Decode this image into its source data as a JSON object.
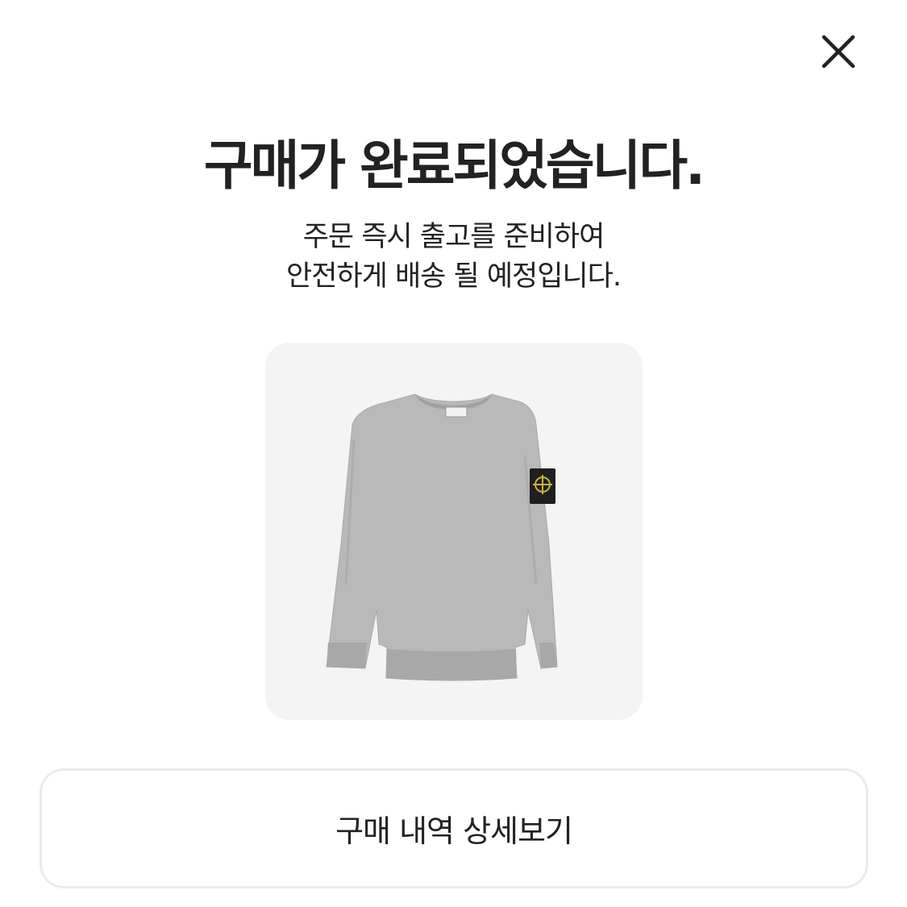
{
  "header": {
    "close_icon": "close-icon"
  },
  "main": {
    "title": "구매가 완료되었습니다.",
    "subtitle_line1": "주문 즉시 출고를 준비하여",
    "subtitle_line2": "안전하게 배송 될 예정입니다."
  },
  "product": {
    "image": "gray crewneck sweatshirt with black badge on left sleeve",
    "badge_icon": "compass-badge-icon"
  },
  "actions": {
    "detail_button_label": "구매 내역 상세보기"
  },
  "colors": {
    "background": "#ffffff",
    "text": "#222222",
    "card_background": "#f4f4f4",
    "button_border": "#ebebeb"
  }
}
